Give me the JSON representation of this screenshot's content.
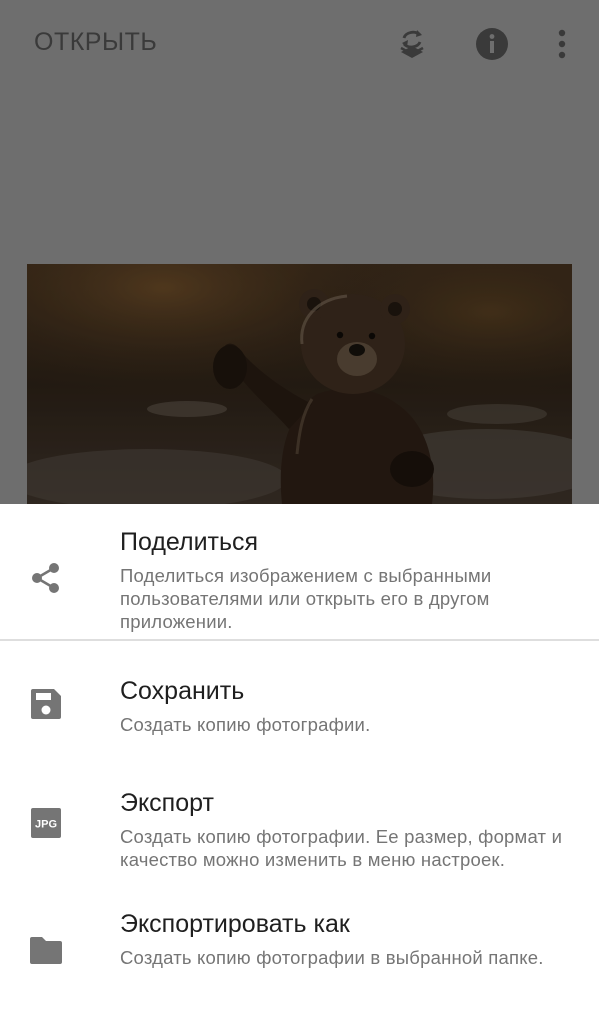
{
  "toolbar": {
    "open_label": "ОТКРЫТЬ",
    "icons": [
      "layers-swap-icon",
      "info-icon",
      "more-vert-icon"
    ]
  },
  "photo": {
    "subject": "bear"
  },
  "menu": {
    "items": [
      {
        "icon": "share-icon",
        "title": "Поделиться",
        "description": "Поделиться изображением с выбранными пользователями или открыть его в другом приложении."
      },
      {
        "icon": "save-icon",
        "title": "Сохранить",
        "description": "Создать копию фотографии."
      },
      {
        "icon": "jpg-icon",
        "icon_text": "JPG",
        "title": "Экспорт",
        "description": "Создать копию фотографии. Ее размер, формат и качество можно изменить в меню настроек."
      },
      {
        "icon": "folder-icon",
        "title": "Экспортировать как",
        "description": "Создать копию фотографии в выбранной папке."
      }
    ]
  },
  "colors": {
    "scrim_background": "#6e6e6e",
    "icon_gray": "#757575",
    "title_text": "#1f1f1f",
    "description_text": "#757575"
  }
}
